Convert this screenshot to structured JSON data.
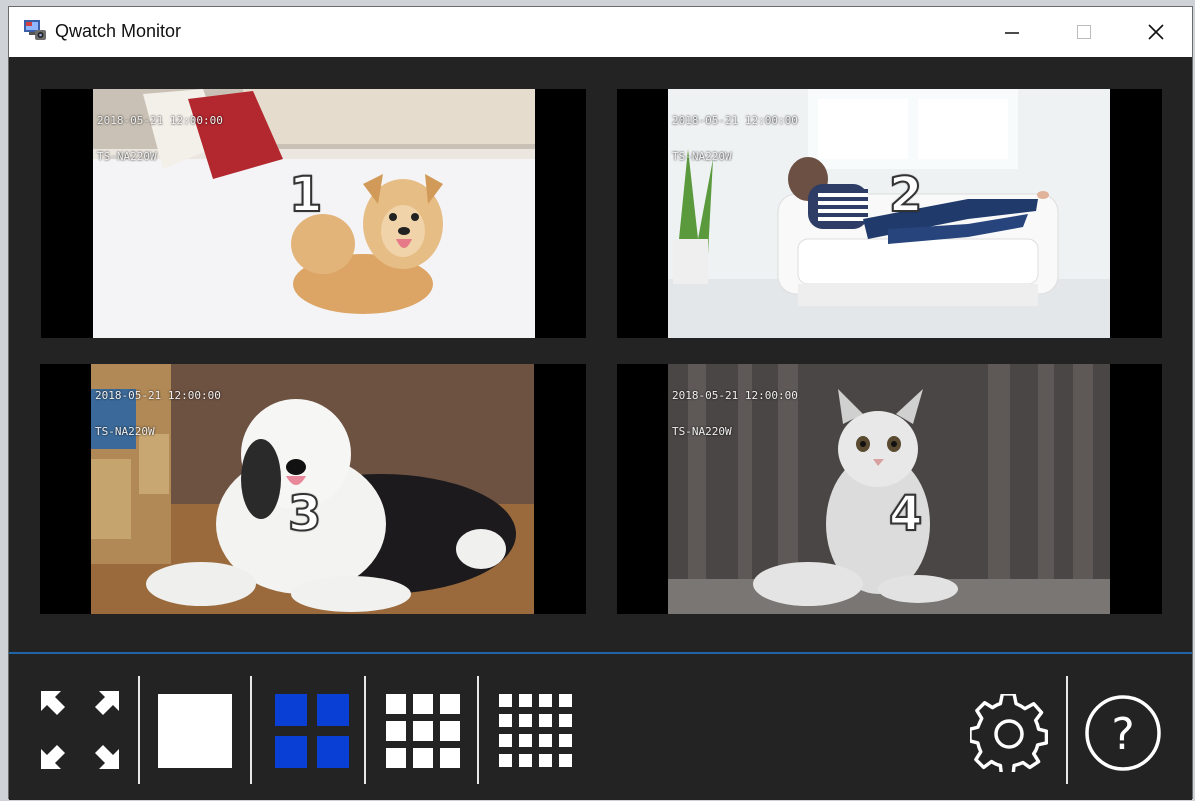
{
  "window": {
    "title": "Qwatch Monitor",
    "controls": {
      "minimize_icon": "minimize-icon",
      "maximize_icon": "maximize-icon",
      "close_icon": "close-icon"
    }
  },
  "cameras": [
    {
      "number": "1",
      "timestamp": "2018-05-21 12:00:00",
      "device": "TS-NA220W",
      "subject": "dog lying on white rug"
    },
    {
      "number": "2",
      "timestamp": "2018-05-21 12:00:00",
      "device": "TS-NA220W",
      "subject": "person lying on white sofa"
    },
    {
      "number": "3",
      "timestamp": "2018-05-21 12:00:00",
      "device": "TS-NA220W",
      "subject": "sheepdog lying on wooden floor"
    },
    {
      "number": "4",
      "timestamp": "2018-05-21 12:00:00",
      "device": "TS-NA220W",
      "subject": "white cat sitting"
    }
  ],
  "toolbar": {
    "buttons": [
      {
        "name": "fullscreen-button",
        "icon": "fullscreen-arrows-icon"
      },
      {
        "name": "layout-1-button",
        "icon": "layout-1x1-icon",
        "active": false
      },
      {
        "name": "layout-4-button",
        "icon": "layout-2x2-icon",
        "active": true
      },
      {
        "name": "layout-9-button",
        "icon": "layout-3x3-icon",
        "active": false
      },
      {
        "name": "layout-16-button",
        "icon": "layout-4x4-icon",
        "active": false
      },
      {
        "name": "settings-button",
        "icon": "gear-icon"
      },
      {
        "name": "help-button",
        "icon": "help-icon"
      }
    ],
    "help_glyph": "?"
  },
  "colors": {
    "active_layout": "#0a3fd6",
    "inactive_layout": "#ffffff",
    "background": "#232323",
    "toolbar_separator": "#1f63a8"
  }
}
